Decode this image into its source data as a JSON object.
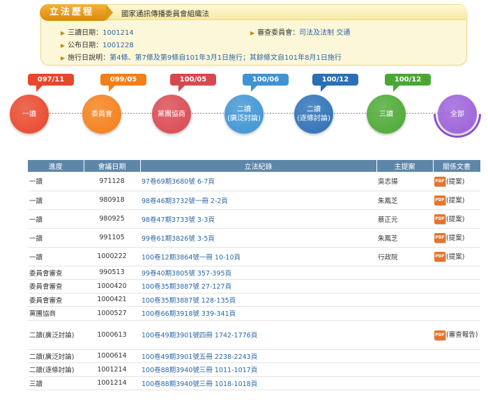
{
  "header": {
    "badge": "立法歷程",
    "bill_title": "國家通訊傳播委員會組織法"
  },
  "info": {
    "third_reading_label": "三讀日期：",
    "third_reading_value": "1001214",
    "committee_label": "審查委員會：",
    "committee_value": "司法及法制 交通",
    "promulgation_label": "公布日期：",
    "promulgation_value": "1001228",
    "effective_label": "施行日說明：",
    "effective_value": "第4條、第7條及第9條自101年3月1日施行；其餘條文自101年8月1日施行"
  },
  "timeline": [
    {
      "date": "097/11",
      "label": "一讀",
      "color": "#e9462a",
      "bubble": "#e9462a"
    },
    {
      "date": "099/05",
      "label": "委員會",
      "color": "#f47e17",
      "bubble": "#f47e17"
    },
    {
      "date": "100/05",
      "label": "黨團協商",
      "color": "#d9474f",
      "bubble": "#d9474f"
    },
    {
      "date": "100/06",
      "label": "二讀\n(廣泛討論)",
      "color": "#3d93d3",
      "bubble": "#3d93d3"
    },
    {
      "date": "100/12",
      "label": "二讀\n(逐條討論)",
      "color": "#2b6fb6",
      "bubble": "#2b6fb6"
    },
    {
      "date": "100/12",
      "label": "三讀",
      "color": "#4aa832",
      "bubble": "#4aa832"
    },
    {
      "date": "",
      "label": "全部",
      "color": "#9b5fd9",
      "bubble": ""
    }
  ],
  "table": {
    "headers": [
      "進度",
      "會議日期",
      "立法紀錄",
      "主提案",
      "關係文書"
    ],
    "rows": [
      {
        "progress": "一讀",
        "date": "971128",
        "record": "97卷69期3680號 6-7頁",
        "proposer": "吳志揚",
        "doc": "(提案)",
        "pdf": true
      },
      {
        "progress": "一讀",
        "date": "980918",
        "record": "98卷46期3732號一冊 2-2頁",
        "proposer": "朱鳳芝",
        "doc": "(提案)",
        "pdf": true
      },
      {
        "progress": "一讀",
        "date": "980925",
        "record": "98卷47期3733號 3-3頁",
        "proposer": "蔡正元",
        "doc": "(提案)",
        "pdf": true
      },
      {
        "progress": "一讀",
        "date": "991105",
        "record": "99卷61期3826號 3-5頁",
        "proposer": "朱鳳芝",
        "doc": "(提案)",
        "pdf": true
      },
      {
        "progress": "一讀",
        "date": "1000222",
        "record": "100卷12期3864號一冊 10-10頁",
        "proposer": "行政院",
        "doc": "(提案)",
        "pdf": true
      },
      {
        "progress": "委員會審查",
        "date": "990513",
        "record": "99卷40期3805號 357-395頁",
        "proposer": "",
        "doc": "",
        "pdf": false
      },
      {
        "progress": "委員會審查",
        "date": "1000420",
        "record": "100卷35期3887號 27-127頁",
        "proposer": "",
        "doc": "",
        "pdf": false
      },
      {
        "progress": "委員會審查",
        "date": "1000421",
        "record": "100卷35期3887號 128-135頁",
        "proposer": "",
        "doc": "",
        "pdf": false
      },
      {
        "progress": "黨團協商",
        "date": "1000527",
        "record": "100卷66期3918號 339-341頁",
        "proposer": "",
        "doc": "",
        "pdf": false
      },
      {
        "progress": "二讀(廣泛討論)",
        "date": "1000613",
        "record": "100卷49期3901號四冊 1742-1776頁",
        "proposer": "",
        "doc": "(審查報告)",
        "pdf": true
      },
      {
        "progress": "二讀(廣泛討論)",
        "date": "1000614",
        "record": "100卷49期3901號五冊 2238-2243頁",
        "proposer": "",
        "doc": "",
        "pdf": false
      },
      {
        "progress": "二讀(逐條討論)",
        "date": "1001214",
        "record": "100卷88期3940號三冊 1011-1017頁",
        "proposer": "",
        "doc": "",
        "pdf": false
      },
      {
        "progress": "三讀",
        "date": "1001214",
        "record": "100卷88期3940號三冊 1018-1018頁",
        "proposer": "",
        "doc": "",
        "pdf": false
      }
    ]
  },
  "icons": {
    "pdf": "pdf-icon",
    "arrow": "arrow-right-icon"
  },
  "pdf_icon_text": "PDF"
}
